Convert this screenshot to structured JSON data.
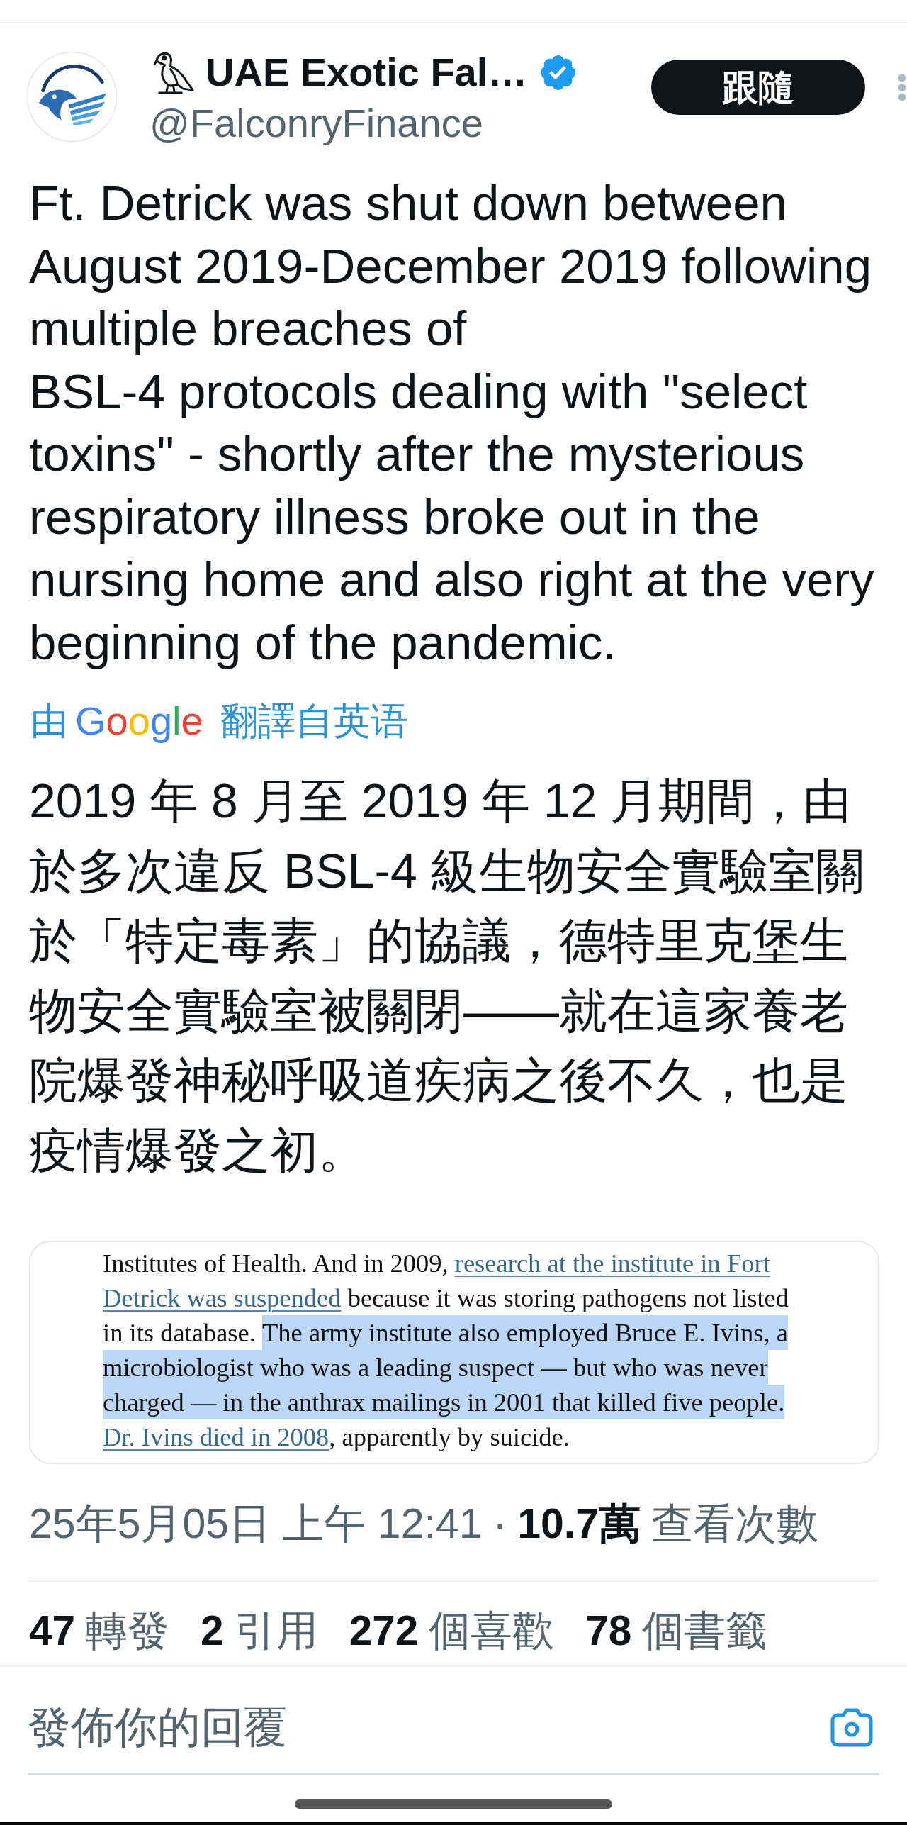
{
  "author": {
    "display_name": "UAE Exotic Fal…",
    "verified": true,
    "handle": "@FalconryFinance"
  },
  "follow_button": {
    "label": "跟隨"
  },
  "tweet": {
    "text": "Ft. Detrick was shut down between August 2019-December 2019 following multiple breaches of\nBSL-4 protocols dealing with \"select toxins\" - shortly after the mysterious respiratory illness broke out in the nursing home and also right at the very beginning of the pandemic.",
    "translation_label": {
      "prefix": "由",
      "brand": "Google",
      "suffix": "翻譯自英语"
    },
    "translated_text": "2019 年 8 月至 2019 年 12 月期間，由於多次違反 BSL-4 級生物安全實驗室關於「特定毒素」的協議，德特里克堡生物安全實驗室被關閉——就在這家養老院爆發神秘呼吸道疾病之後不久，也是疫情爆發之初。",
    "article_screenshot": {
      "lines": [
        [
          {
            "kind": "text",
            "text": "Institutes of Health. And in 2009, "
          },
          {
            "kind": "link",
            "text": "research at the institute in Fort"
          }
        ],
        [
          {
            "kind": "link",
            "text": "Detrick was suspended"
          },
          {
            "kind": "text",
            "text": " because it was storing pathogens not listed"
          }
        ],
        [
          {
            "kind": "text",
            "text": "in its database. "
          },
          {
            "kind": "highlight",
            "text": "The army institute also employed Bruce E. Ivins, a"
          }
        ],
        [
          {
            "kind": "highlight",
            "text": "microbiologist who was a leading suspect — but who was never"
          }
        ],
        [
          {
            "kind": "highlight",
            "text": "charged — in the anthrax mailings in 2001 that killed five people."
          }
        ],
        [
          {
            "kind": "link",
            "text": "Dr. Ivins died in 2008"
          },
          {
            "kind": "text",
            "text": ", apparently by suicide."
          }
        ]
      ]
    },
    "timestamp": "25年5月05日 上午 12:41",
    "separator": "·",
    "views": {
      "count": "10.7萬",
      "label": "查看次數"
    },
    "stats": [
      {
        "count": "47",
        "label": "轉發"
      },
      {
        "count": "2",
        "label": "引用"
      },
      {
        "count": "272",
        "label": "個喜歡"
      },
      {
        "count": "78",
        "label": "個書籤"
      }
    ]
  },
  "reply_box": {
    "placeholder": "發佈你的回覆"
  }
}
